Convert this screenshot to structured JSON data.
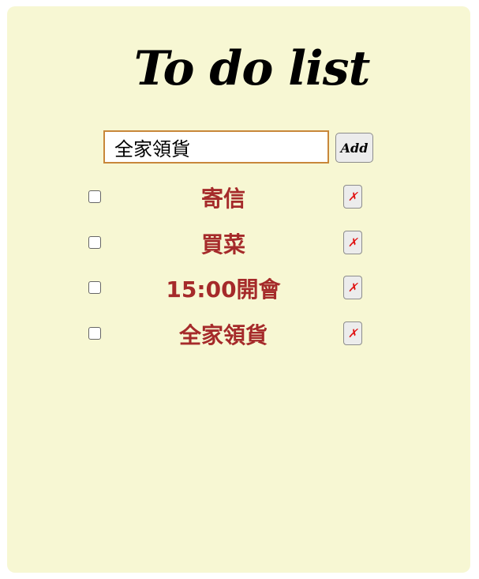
{
  "app": {
    "title": "To do list"
  },
  "input": {
    "value": "全家領貨",
    "add_label": "Add"
  },
  "todos": [
    {
      "text": "寄信",
      "checked": false,
      "delete_label": "✗"
    },
    {
      "text": "買菜",
      "checked": false,
      "delete_label": "✗"
    },
    {
      "text": "15:00開會",
      "checked": false,
      "delete_label": "✗"
    },
    {
      "text": "全家領貨",
      "checked": false,
      "delete_label": "✗"
    }
  ],
  "colors": {
    "background": "#f7f7d3",
    "item_text": "#a52a2a",
    "delete_x": "#e01010",
    "input_border": "#c8873a"
  }
}
